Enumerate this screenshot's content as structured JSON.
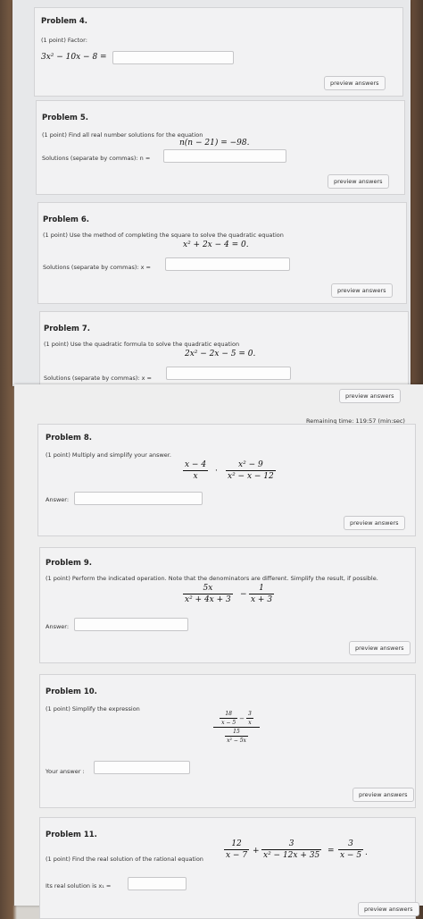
{
  "p4": {
    "title": "Problem 4.",
    "text": "(1 point) Factor:",
    "expr": "3x² − 10x − 8 =",
    "preview": "preview answers"
  },
  "p5": {
    "title": "Problem 5.",
    "text": "(1 point) Find all real number solutions for the equation",
    "equation": "n(n − 21) = −98.",
    "answer_label": "Solutions (separate by commas): n =",
    "preview": "preview answers"
  },
  "p6": {
    "title": "Problem 6.",
    "text": "(1 point) Use the method of completing the square to solve the quadratic equation",
    "equation": "x² + 2x − 4 = 0.",
    "answer_label": "Solutions (separate by commas): x =",
    "preview": "preview answers"
  },
  "p7": {
    "title": "Problem 7.",
    "text": "(1 point) Use the quadratic formula to solve the quadratic equation",
    "equation": "2x² − 2x − 5 = 0.",
    "answer_label": "Solutions (separate by commas): x =",
    "preview": "preview answers"
  },
  "remaining_time": "Remaining time: 119:57 (min:sec)",
  "p8": {
    "title": "Problem 8.",
    "text": "(1 point) Multiply and simplify your answer.",
    "f1_num": "x − 4",
    "f1_den": "x",
    "dot": "·",
    "f2_num": "x² − 9",
    "f2_den": "x² − x − 12",
    "answer_label": "Answer:",
    "preview": "preview answers"
  },
  "p9": {
    "title": "Problem 9.",
    "text": "(1 point) Perform the indicated operation. Note that the denominators are different. Simplify the result, if possible.",
    "f1_num": "5x",
    "f1_den": "x² + 4x + 3",
    "minus": "−",
    "f2_num": "1",
    "f2_den": "x + 3",
    "answer_label": "Answer:",
    "preview": "preview answers"
  },
  "p10": {
    "title": "Problem 10.",
    "text": "(1 point) Simplify the expression",
    "a_num": "18",
    "a_den": "x − 5",
    "minus": "−",
    "b_num": "3",
    "b_den": "x",
    "c_num": "15",
    "c_den": "x² − 5x",
    "answer_label": "Your answer :",
    "preview": "preview answers"
  },
  "p11": {
    "title": "Problem 11.",
    "text": "(1 point) Find the real solution of the rational equation",
    "f1_num": "12",
    "f1_den": "x − 7",
    "plus": "+",
    "f2_num": "3",
    "f2_den": "x² − 12x + 35",
    "eq": "=",
    "f3_num": "3",
    "f3_den": "x − 5",
    "period": ".",
    "answer_label": "Its real solution is x₁ =",
    "preview": "preview answers"
  }
}
